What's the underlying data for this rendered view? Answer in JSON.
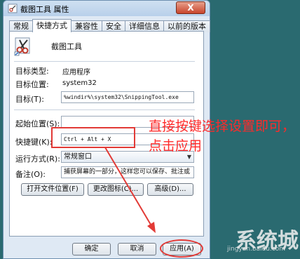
{
  "window": {
    "title": "截图工具 属性",
    "close_label": "X"
  },
  "tabs": [
    {
      "label": "常规"
    },
    {
      "label": "快捷方式"
    },
    {
      "label": "兼容性"
    },
    {
      "label": "安全"
    },
    {
      "label": "详细信息"
    },
    {
      "label": "以前的版本"
    }
  ],
  "shortcut": {
    "name": "截图工具",
    "target_type_label": "目标类型:",
    "target_type_value": "应用程序",
    "target_location_label": "目标位置:",
    "target_location_value": "system32",
    "target_label": "目标(T):",
    "target_value": "%windir%\\system32\\SnippingTool.exe",
    "start_in_label": "起始位置(S):",
    "start_in_value": "",
    "hotkey_label": "快捷键(K):",
    "hotkey_value": "Ctrl + Alt + X",
    "run_label": "运行方式(R):",
    "run_value": "常规窗口",
    "comment_label": "备注(O):",
    "comment_value": "捕获屏幕的一部分，这样您可以保存、批注或"
  },
  "buttons": {
    "open_location": "打开文件位置(F)",
    "change_icon": "更改图标(C)...",
    "advanced": "高级(D)...",
    "ok": "确定",
    "cancel": "取消",
    "apply": "应用(A)"
  },
  "annotation": {
    "text": "直接按键选择设置即可，点击应用"
  },
  "watermark": {
    "main": "系统城",
    "sub": "jingyan.baidu.com"
  },
  "colors": {
    "annotation": "#e23a36",
    "annotation_text": "#ff2a2a",
    "background": "#2a6a70"
  }
}
